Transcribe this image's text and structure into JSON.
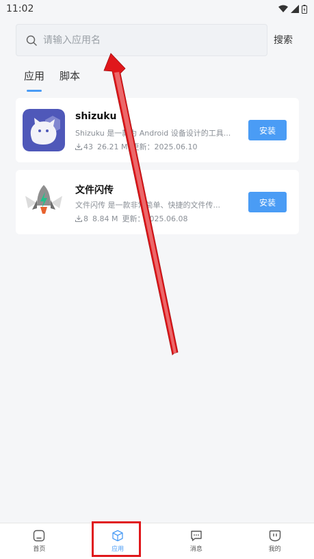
{
  "status_bar": {
    "time": "11:02"
  },
  "search": {
    "placeholder": "请输入应用名",
    "button_label": "搜索"
  },
  "tabs": [
    {
      "label": "应用",
      "active": true
    },
    {
      "label": "脚本",
      "active": false
    }
  ],
  "apps": [
    {
      "name": "shizuku",
      "description": "Shizuku 是一款为 Android 设备设计的工具...",
      "downloads": "43",
      "size": "26.21 M",
      "updated": "更新：2025.06.10",
      "install_label": "安装"
    },
    {
      "name": "文件闪传",
      "description": "文件闪传 是一款非常简单、快捷的文件传...",
      "downloads": "8",
      "size": "8.84 M",
      "updated": "更新：2025.06.08",
      "install_label": "安装"
    }
  ],
  "bottom_nav": [
    {
      "label": "首页",
      "icon": "home-icon",
      "active": false
    },
    {
      "label": "应用",
      "icon": "apps-cube-icon",
      "active": true
    },
    {
      "label": "消息",
      "icon": "message-icon",
      "active": false
    },
    {
      "label": "我的",
      "icon": "profile-icon",
      "active": false
    }
  ],
  "colors": {
    "accent": "#4a9cf5",
    "annotation": "#e0171b"
  }
}
